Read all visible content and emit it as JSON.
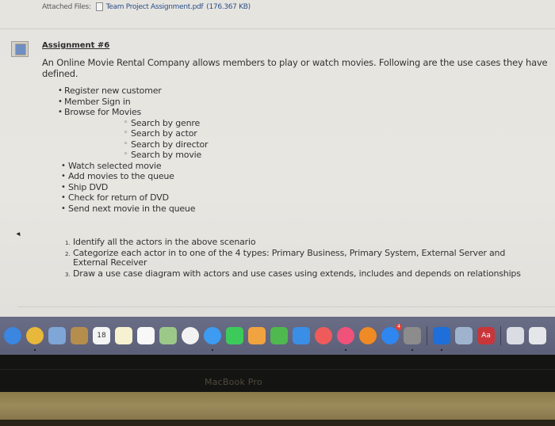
{
  "attachments": {
    "label": "Attached Files:",
    "file_name": "Team Project Assignment.pdf",
    "file_size": "(176.367 KB)"
  },
  "assignment": {
    "title": "Assignment #6",
    "intro": "An Online Movie Rental Company allows members to play or watch movies. Following are the use cases they have defined.",
    "use_cases": [
      {
        "label": "Register new customer",
        "level": 1
      },
      {
        "label": "Member Sign in",
        "level": 1
      },
      {
        "label": "Browse for Movies",
        "level": 1
      },
      {
        "label": "Search by genre",
        "level": 2
      },
      {
        "label": "Search by actor",
        "level": 2
      },
      {
        "label": "Search by director",
        "level": 2
      },
      {
        "label": "Search by movie",
        "level": 2
      },
      {
        "label": "Watch selected movie",
        "level": 1
      },
      {
        "label": "Add movies to the queue",
        "level": 1
      },
      {
        "label": "Ship DVD",
        "level": 1
      },
      {
        "label": "Check for return of DVD",
        "level": 1
      },
      {
        "label": "Send next movie in the queue",
        "level": 1
      }
    ],
    "tasks": [
      {
        "num": "1.",
        "text": "Identify all the actors in the above scenario"
      },
      {
        "num": "2.",
        "text": "Categorize each actor in to one of the 4 types: Primary Business, Primary System, External Server and External Receiver"
      },
      {
        "num": "3.",
        "text": "Draw a use case diagram with actors and use cases using extends, includes and depends on relationships"
      }
    ]
  },
  "dock": {
    "items": [
      {
        "name": "safari",
        "icon": "compass-icon",
        "color": "#3a86e0",
        "running": false
      },
      {
        "name": "chrome",
        "icon": "chrome-icon",
        "color": "#e8b83a",
        "running": true
      },
      {
        "name": "preview",
        "icon": "photo-icon",
        "color": "#7ea6d6",
        "running": false
      },
      {
        "name": "contacts",
        "icon": "contacts-icon",
        "color": "#b58e4e",
        "running": false
      },
      {
        "name": "calendar",
        "icon": "calendar-icon",
        "color": "#f4f4f4",
        "label": "18",
        "running": false
      },
      {
        "name": "notes",
        "icon": "notes-icon",
        "color": "#f6f1d0",
        "running": false
      },
      {
        "name": "reminders",
        "icon": "reminders-icon",
        "color": "#f8f8f8",
        "running": false
      },
      {
        "name": "maps",
        "icon": "map-icon",
        "color": "#9cc98a",
        "running": false
      },
      {
        "name": "photos",
        "icon": "photos-icon",
        "color": "#f2f2f2",
        "running": false
      },
      {
        "name": "messages",
        "icon": "message-icon",
        "color": "#3d9cf2",
        "running": true
      },
      {
        "name": "facetime",
        "icon": "video-icon",
        "color": "#3ccb5a",
        "running": false
      },
      {
        "name": "pages",
        "icon": "pages-icon",
        "color": "#f1a340",
        "running": false
      },
      {
        "name": "numbers",
        "icon": "chart-icon",
        "color": "#4fb84e",
        "running": false
      },
      {
        "name": "keynote",
        "icon": "keynote-icon",
        "color": "#3a8ee6",
        "running": false
      },
      {
        "name": "news",
        "icon": "news-icon",
        "color": "#ef5b5b",
        "running": false
      },
      {
        "name": "music",
        "icon": "music-icon",
        "color": "#f0527a",
        "running": true
      },
      {
        "name": "books",
        "icon": "book-icon",
        "color": "#f08a24",
        "running": false
      },
      {
        "name": "app-store",
        "icon": "app-store-icon",
        "color": "#2f86f0",
        "badge": "4",
        "running": false
      },
      {
        "name": "system-preferences",
        "icon": "gear-icon",
        "color": "#8c8c8c",
        "running": true
      },
      {
        "name": "teamviewer",
        "icon": "teamviewer-icon",
        "color": "#1e6fd9",
        "running": true
      },
      {
        "name": "image-capture",
        "icon": "photos-stack-icon",
        "color": "#9fb3cf",
        "running": false
      },
      {
        "name": "dictionary",
        "icon": "dictionary-icon",
        "color": "#c8363a",
        "label": "Aa",
        "running": false
      },
      {
        "name": "downloads-folder",
        "icon": "folder-icon",
        "color": "#d9dde3",
        "running": false
      },
      {
        "name": "trash",
        "icon": "trash-icon",
        "color": "#e4e6ea",
        "running": false
      }
    ]
  },
  "device": {
    "brand_label": "MacBook Pro"
  }
}
